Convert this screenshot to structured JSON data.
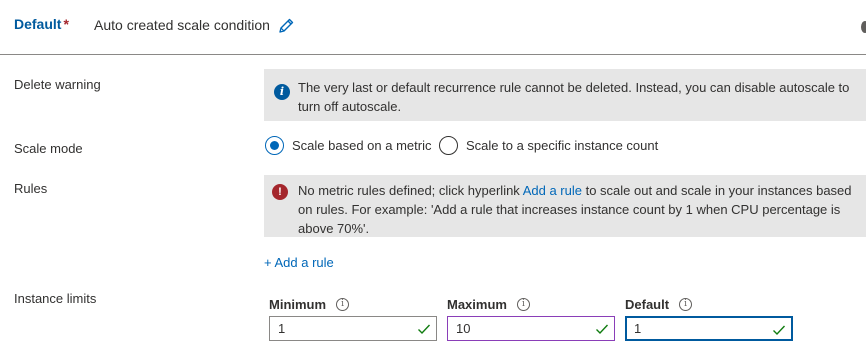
{
  "header": {
    "profile_name": "Default",
    "required_mark": "*",
    "condition_title": "Auto created scale condition",
    "edit_icon": "pencil-icon"
  },
  "delete_warning": {
    "label": "Delete warning",
    "icon": "info-icon",
    "message": "The very last or default recurrence rule cannot be deleted. Instead, you can disable autoscale to turn off autoscale."
  },
  "scale_mode": {
    "label": "Scale mode",
    "options": [
      {
        "label": "Scale based on a metric",
        "selected": true
      },
      {
        "label": "Scale to a specific instance count",
        "selected": false
      }
    ]
  },
  "rules": {
    "label": "Rules",
    "icon": "error-icon",
    "message_prefix": "No metric rules defined; click hyperlink ",
    "message_link": "Add a rule",
    "message_suffix": " to scale out and scale in your instances based on rules. For example: 'Add a rule that increases instance count by 1 when CPU percentage is above 70%'.",
    "add_rule_label": "+ Add a rule"
  },
  "instance_limits": {
    "label": "Instance limits",
    "fields": [
      {
        "label": "Minimum",
        "value": "1"
      },
      {
        "label": "Maximum",
        "value": "10"
      },
      {
        "label": "Default",
        "value": "1"
      }
    ]
  },
  "colors": {
    "accent": "#0067b8",
    "error": "#a4262c",
    "valid_check": "#107c10",
    "message_bar_bg": "#e6e6e6"
  }
}
